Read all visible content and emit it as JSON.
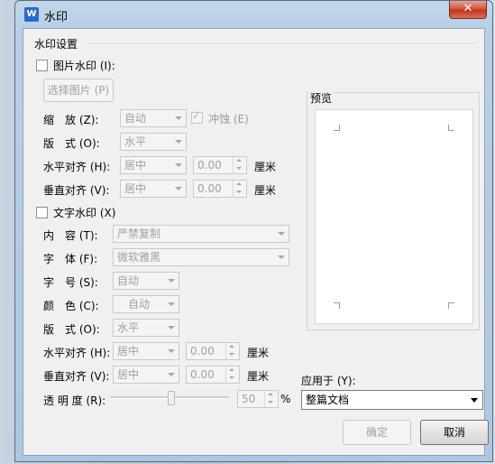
{
  "window": {
    "title": "水印",
    "app_icon": "W",
    "close": "✕"
  },
  "settings_group": {
    "title": "水印设置"
  },
  "picture_watermark": {
    "checkbox_label": "图片水印 (I):",
    "select_button": "选择图片 (P)",
    "scale": {
      "label": "缩　放 (Z):",
      "value": "自动"
    },
    "wash": {
      "label": "冲蚀 (E)",
      "checked": true
    },
    "layout": {
      "label": "版　式 (O):",
      "value": "水平"
    },
    "h_align": {
      "label": "水平对齐 (H):",
      "value": "居中",
      "offset": "0.00",
      "unit": "厘米"
    },
    "v_align": {
      "label": "垂直对齐 (V):",
      "value": "居中",
      "offset": "0.00",
      "unit": "厘米"
    }
  },
  "text_watermark": {
    "checkbox_label": "文字水印 (X)",
    "content": {
      "label": "内　容 (T):",
      "value": "严禁复制"
    },
    "font": {
      "label": "字　体 (F):",
      "value": "微软雅黑"
    },
    "size": {
      "label": "字　号 (S):",
      "value": "自动"
    },
    "color": {
      "label": "颜　色 (C):",
      "value": "自动"
    },
    "layout": {
      "label": "版　式 (O):",
      "value": "水平"
    },
    "h_align": {
      "label": "水平对齐 (H):",
      "value": "居中",
      "offset": "0.00",
      "unit": "厘米"
    },
    "v_align": {
      "label": "垂直对齐 (V):",
      "value": "居中",
      "offset": "0.00",
      "unit": "厘米"
    },
    "transparency": {
      "label": "透 明 度 (R):",
      "value": "50",
      "unit": "%"
    }
  },
  "preview": {
    "label": "预览"
  },
  "apply_to": {
    "label": "应用于 (Y):",
    "value": "整篇文档"
  },
  "buttons": {
    "ok": "确定",
    "cancel": "取消"
  },
  "colors": {
    "title_bar": "#b9cfe6",
    "close_button": "#c1351f",
    "disabled_text": "#a0a0a0"
  }
}
